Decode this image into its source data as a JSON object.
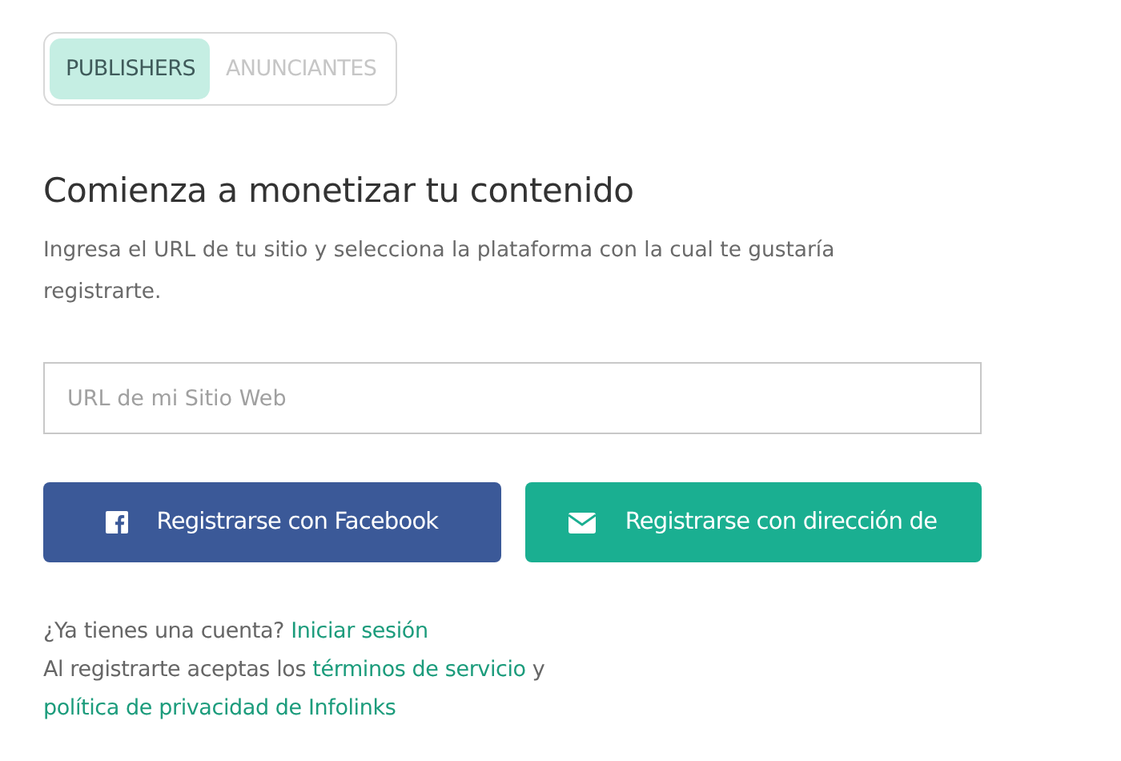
{
  "tabs": [
    {
      "label": "PUBLISHERS",
      "selected": true
    },
    {
      "label": "ANUNCIANTES",
      "selected": false
    }
  ],
  "heading": "Comienza a monetizar tu contenido",
  "intro": "Ingresa el URL de tu sitio y selecciona la plataforma con la cual te gustaría registrarte.",
  "url_field": {
    "placeholder": "URL de mi Sitio Web"
  },
  "buttons": [
    {
      "kind": "facebook",
      "label": "Registrarse con Facebook"
    },
    {
      "kind": "email",
      "label": "Registrarse con dirección de"
    }
  ],
  "footer": [
    {
      "parts": [
        {
          "kind": "text",
          "text": "¿Ya tienes una cuenta? "
        },
        {
          "kind": "link",
          "text": "Iniciar sesión"
        }
      ]
    },
    {
      "parts": [
        {
          "kind": "text",
          "text": "Al registrarte aceptas los "
        },
        {
          "kind": "link",
          "text": "términos de servicio"
        },
        {
          "kind": "text",
          "text": " y "
        },
        {
          "kind": "link",
          "text": "política de privacidad de Infolinks"
        }
      ]
    }
  ]
}
